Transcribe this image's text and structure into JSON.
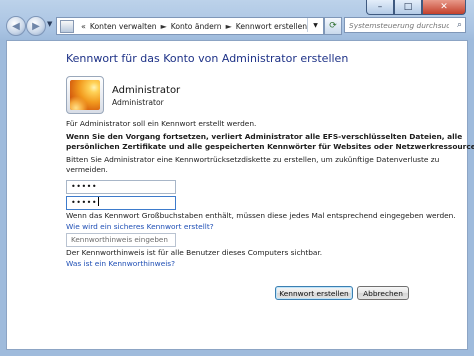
{
  "window": {
    "minimize_glyph": "–",
    "maximize_glyph": "□",
    "close_glyph": "✕"
  },
  "nav": {
    "back_icon": "back-arrow-icon",
    "forward_icon": "forward-arrow-icon",
    "breadcrumb": [
      "Konten verwalten",
      "Konto ändern",
      "Kennwort erstellen"
    ],
    "separator": "►",
    "search_placeholder": "Systemsteuerung durchsuchen"
  },
  "page": {
    "title": "Kennwort für das Konto von Administrator erstellen",
    "user": {
      "name": "Administrator",
      "role": "Administrator"
    },
    "info": "Für Administrator soll ein Kennwort erstellt werden.",
    "warning": [
      "Wenn Sie den Vorgang fortsetzen, verliert Administrator alle EFS-verschlüsselten Dateien, alle",
      "persönlichen Zertifikate und alle gespeicherten Kennwörter für Websites oder Netzwerkressourcen."
    ],
    "reset_disk_note": [
      "Bitten Sie Administrator eine Kennwortrücksetzdiskette zu erstellen, um zukünftige Datenverluste zu",
      "vermeiden."
    ],
    "password_value": "•••••",
    "confirm_value": "•••••",
    "case_note": "Wenn das Kennwort Großbuchstaben enthält, müssen diese jedes Mal entsprechend eingegeben werden.",
    "secure_password_link": "Wie wird ein sicheres Kennwort erstellt?",
    "hint_placeholder": "Kennworthinweis eingeben",
    "hint_note": "Der Kennworthinweis ist für alle Benutzer dieses Computers sichtbar.",
    "hint_link": "Was ist ein Kennworthinweis?",
    "create_button": "Kennwort erstellen",
    "cancel_button": "Abbrechen"
  }
}
